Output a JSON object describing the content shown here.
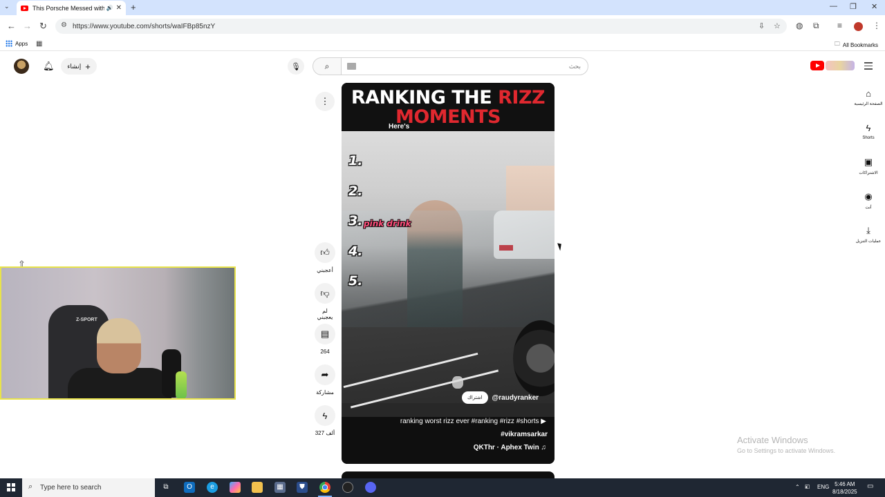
{
  "browser": {
    "tab_title": "This Porsche Messed with t",
    "url": "https://www.youtube.com/shorts/waIFBp85nzY",
    "bookmarks": {
      "apps_label": "Apps",
      "all_label": "All Bookmarks"
    }
  },
  "youtube": {
    "create_label": "إنشاء",
    "search_placeholder": "بحث",
    "guide": [
      {
        "label": "الصفحة الرئيسية",
        "icon": "home-icon"
      },
      {
        "label": "Shorts",
        "icon": "shorts-icon"
      },
      {
        "label": "الاشتراكات",
        "icon": "subscriptions-icon"
      },
      {
        "label": "أنت",
        "icon": "you-icon"
      },
      {
        "label": "عمليات التنزيل",
        "icon": "download-icon"
      }
    ]
  },
  "short": {
    "banner_line1_white": "RANKING THE ",
    "banner_line1_red": "RIZZ",
    "banner_line2": "MOMENTS",
    "caption": "Here's",
    "ranks": [
      "1.",
      "2.",
      "3.",
      "4.",
      "5."
    ],
    "rank3_text": "pink drink",
    "subscribe_label": "اشتراك",
    "channel": "@raudyranker",
    "title": "ranking worst rizz ever #ranking #rizz #shorts",
    "hashtag": "#vikramsarkar",
    "music": "QKThr · Aphex Twin"
  },
  "actions": {
    "like_label": "أعجبني",
    "dislike_label": "لم يعجبني",
    "comments_count": "264",
    "share_label": "مشاركة",
    "remix_count": "327 ألف"
  },
  "watermark": {
    "line1": "Activate Windows",
    "line2": "Go to Settings to activate Windows."
  },
  "taskbar": {
    "search_placeholder": "Type here to search",
    "language": "ENG",
    "time": "5:46 AM",
    "date": "8/18/2025"
  },
  "colors": {
    "youtube_red": "#ff0000",
    "banner_red": "#e0282f",
    "webcam_border": "#e8e34a"
  }
}
